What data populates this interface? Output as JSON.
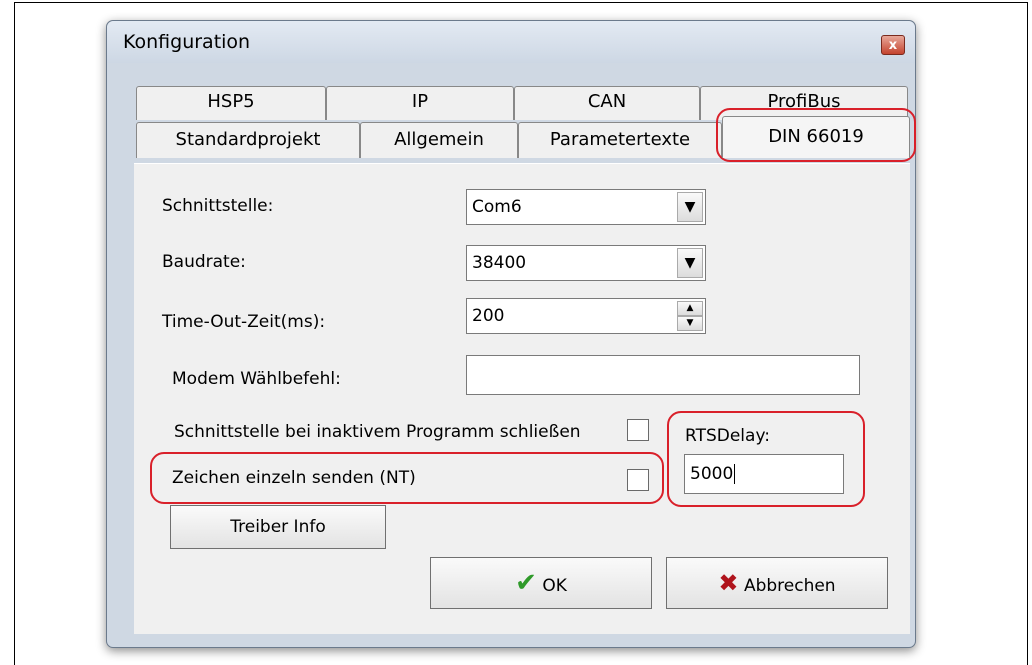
{
  "window": {
    "title": "Konfiguration",
    "close_glyph": "x"
  },
  "tabs": {
    "back_row": [
      "HSP5",
      "IP",
      "CAN",
      "ProfiBus"
    ],
    "front_row": [
      "Standardprojekt",
      "Allgemein",
      "Parametertexte",
      "DIN 66019"
    ],
    "active": "DIN 66019"
  },
  "form": {
    "schnittstelle_label": "Schnittstelle:",
    "schnittstelle_value": "Com6",
    "baudrate_label": "Baudrate:",
    "baudrate_value": "38400",
    "timeout_label": "Time-Out-Zeit(ms):",
    "timeout_value": "200",
    "modem_label": "Modem Wählbefehl:",
    "modem_value": "",
    "close_inactive_label": "Schnittstelle bei inaktivem Programm schließen",
    "close_inactive_checked": false,
    "single_chars_label": "Zeichen einzeln senden (NT)",
    "single_chars_checked": false,
    "rts_label": "RTSDelay:",
    "rts_value": "5000"
  },
  "buttons": {
    "driver_info": "Treiber Info",
    "ok": "OK",
    "cancel": "Abbrechen"
  },
  "icons": {
    "ok": "checkmark-icon",
    "cancel": "x-icon",
    "dropdown": "chevron-down-icon"
  },
  "colors": {
    "highlight": "#d9202a",
    "ok_icon": "#2f9a2a",
    "cancel_icon": "#b0141c"
  }
}
